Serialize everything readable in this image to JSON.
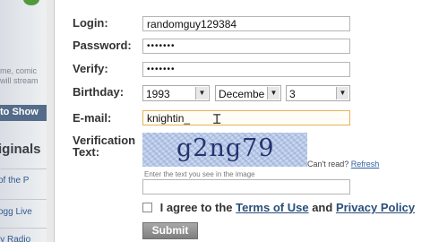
{
  "background_site": {
    "ghost_text_1": "me, comic",
    "ghost_text_2": "will stream",
    "show_button": "to Show",
    "originals_heading": "iginals",
    "link_1": "of the P",
    "link_2": "ogg Live",
    "link_3": "ly Radio"
  },
  "form": {
    "login": {
      "label": "Login:",
      "value": "randomguy129384"
    },
    "password": {
      "label": "Password:",
      "value": "•••••••"
    },
    "verify": {
      "label": "Verify:",
      "value": "•••••••"
    },
    "birthday": {
      "label": "Birthday:",
      "year": "1993",
      "month": "Decembe",
      "day": "3"
    },
    "email": {
      "label": "E-mail:",
      "value": "knightin_"
    },
    "verification": {
      "label_line1": "Verification",
      "label_line2": "Text:",
      "captcha_word": "g2ng79",
      "cant_read": "Can't read?",
      "refresh": "Refresh",
      "hint": "Enter the text you see in the image",
      "value": ""
    },
    "agree": {
      "prefix": "I agree to the",
      "terms": "Terms of Use",
      "and": "and",
      "privacy": "Privacy Policy"
    },
    "submit_label": "Submit"
  }
}
